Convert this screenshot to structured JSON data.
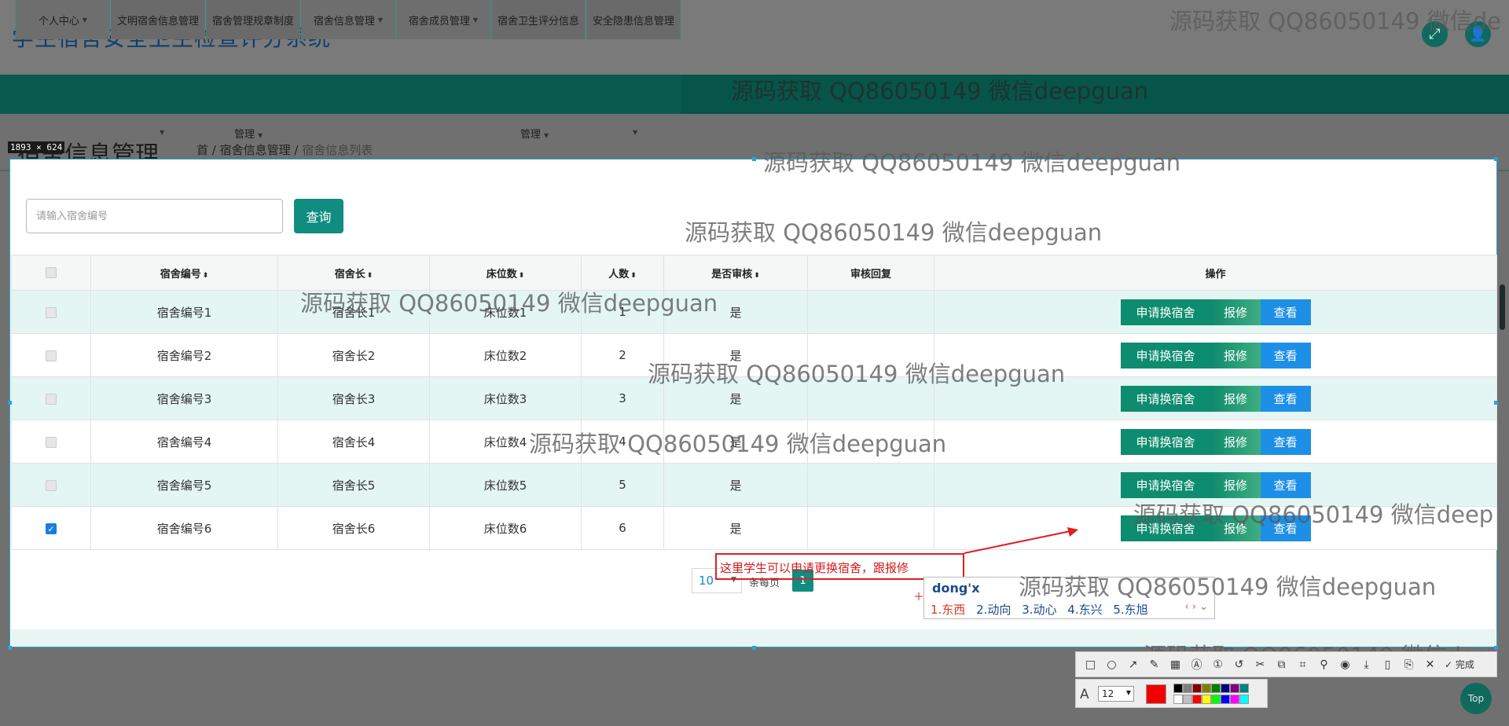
{
  "header": {
    "app_title": "学生宿舍安全卫生检查评分系统",
    "fullscreen_icon": "expand-icon",
    "user_icon": "user-icon"
  },
  "nav": {
    "items": [
      {
        "label": "个人中心",
        "has_caret": true
      },
      {
        "label": "文明宿舍信息管理",
        "has_caret": false
      },
      {
        "label": "宿舍管理规章制度",
        "has_caret": false
      },
      {
        "label": "宿舍信息管理",
        "has_caret": true
      },
      {
        "label": "宿舍成员管理",
        "has_caret": true
      },
      {
        "label": "宿舍卫生评分信息",
        "has_caret": false
      },
      {
        "label": "安全隐患信息管理",
        "has_caret": false
      }
    ],
    "sub_labels": [
      "管理",
      "管理"
    ]
  },
  "breadcrumb": {
    "title": "宿舍信息管理",
    "trail": "首 / 宿舍信息管理 / ",
    "current": "宿舍信息列表"
  },
  "capture": {
    "size_label": "1893 × 624"
  },
  "search": {
    "placeholder": "请输入宿舍编号",
    "button_label": "查询"
  },
  "table": {
    "columns": [
      "",
      "宿舍编号",
      "宿舍长",
      "床位数",
      "人数",
      "是否审核",
      "审核回复",
      "操作"
    ],
    "sortable": [
      false,
      true,
      true,
      true,
      true,
      true,
      false,
      false
    ],
    "rows": [
      {
        "id": "宿舍编号1",
        "leader": "宿舍长1",
        "beds": "床位数1",
        "people": "1",
        "reviewed": "是",
        "reply": "",
        "checked": false
      },
      {
        "id": "宿舍编号2",
        "leader": "宿舍长2",
        "beds": "床位数2",
        "people": "2",
        "reviewed": "是",
        "reply": "",
        "checked": false
      },
      {
        "id": "宿舍编号3",
        "leader": "宿舍长3",
        "beds": "床位数3",
        "people": "3",
        "reviewed": "是",
        "reply": "",
        "checked": false
      },
      {
        "id": "宿舍编号4",
        "leader": "宿舍长4",
        "beds": "床位数4",
        "people": "4",
        "reviewed": "是",
        "reply": "",
        "checked": false
      },
      {
        "id": "宿舍编号5",
        "leader": "宿舍长5",
        "beds": "床位数5",
        "people": "5",
        "reviewed": "是",
        "reply": "",
        "checked": false
      },
      {
        "id": "宿舍编号6",
        "leader": "宿舍长6",
        "beds": "床位数6",
        "people": "6",
        "reviewed": "是",
        "reply": "",
        "checked": true
      }
    ],
    "actions": {
      "apply": "申请换宿舍",
      "repair": "报修",
      "view": "查看"
    }
  },
  "pagination": {
    "page_size": "10",
    "per_page_label": "条每页",
    "current_page": "1"
  },
  "annotation": {
    "note": "这里学生可以申请更换宿舍，跟报修"
  },
  "ime": {
    "input": "dong'x",
    "candidates": [
      "1.东西",
      "2.动向",
      "3.动心",
      "4.东兴",
      "5.东旭"
    ],
    "nav": "‹ › ⌄"
  },
  "watermark": {
    "text": "源码获取 QQ86050149 微信deepguan",
    "text_cut1": "源码获取 QQ86050149 微信de",
    "text_cut2": "源码获取 QQ86050149 微信deep",
    "text_cut3": "源码获取 QQ86050149 微信dee"
  },
  "toolbar": {
    "tools": [
      "rect-icon",
      "ellipse-icon",
      "arrow-icon",
      "pen-icon",
      "mosaic-icon",
      "text-icon",
      "number-icon",
      "undo-icon",
      "pin-icon",
      "copy-icon",
      "ocr-icon",
      "pin2-icon",
      "record-icon",
      "save-icon",
      "long-icon",
      "more-icon",
      "close-icon",
      "done-icon"
    ],
    "done_label": "完成",
    "font_size": "12",
    "text_glyph": "A",
    "current_color": "#f20000",
    "palette": [
      "#000000",
      "#7f7f7f",
      "#800000",
      "#808000",
      "#008000",
      "#000080",
      "#800080",
      "#008080",
      "#ffffff",
      "#c0c0c0",
      "#ff0000",
      "#ffff00",
      "#00ff00",
      "#0000ff",
      "#ff00ff",
      "#00ffff"
    ]
  },
  "top_button": "Top",
  "colors": {
    "primary": "#108c80",
    "header_text": "#0e3f6e",
    "annotation": "#e02020"
  }
}
